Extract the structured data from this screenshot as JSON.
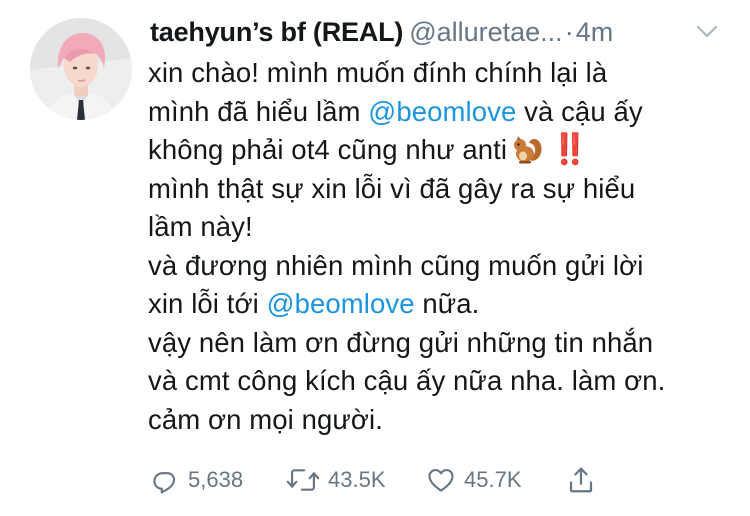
{
  "tweet": {
    "display_name": "taehyun’s bf (REAL)",
    "handle": "@alluretae...",
    "separator": "·",
    "time": "4m",
    "body": {
      "line1": "xin chào! mình muốn đính chính lại là",
      "line2_before": "mình đã hiểu lầm ",
      "mention1": "@beomlove",
      "line2_after": " và cậu ấy",
      "line3": "không phải ot4 cũng như anti",
      "line3_emoji_bang": "‼️",
      "line4": "mình thật sự xin lỗi vì đã gây ra sự hiểu",
      "line5": "lầm này!",
      "line6": "và đương nhiên mình cũng muốn gửi lời",
      "line7_before": "xin lỗi tới ",
      "mention2": "@beomlove",
      "line7_after": " nữa.",
      "line8": "vậy nên làm ơn đừng gửi những tin nhắn",
      "line9": "và cmt công kích cậu ấy nữa nha. làm ơn.",
      "line10": "cảm ơn mọi người."
    },
    "actions": {
      "replies": "5,638",
      "retweets": "43.5K",
      "likes": "45.7K"
    },
    "icons": {
      "avatar": "profile-photo",
      "caret": "chevron-down-icon",
      "reply": "reply-icon",
      "retweet": "retweet-icon",
      "like": "heart-icon",
      "share": "share-icon",
      "squirrel": "chipmunk-emoji"
    },
    "colors": {
      "mention": "#1b95e0",
      "secondary": "#657786",
      "text": "#14171a",
      "emoji_bang": "#e0245e"
    }
  }
}
